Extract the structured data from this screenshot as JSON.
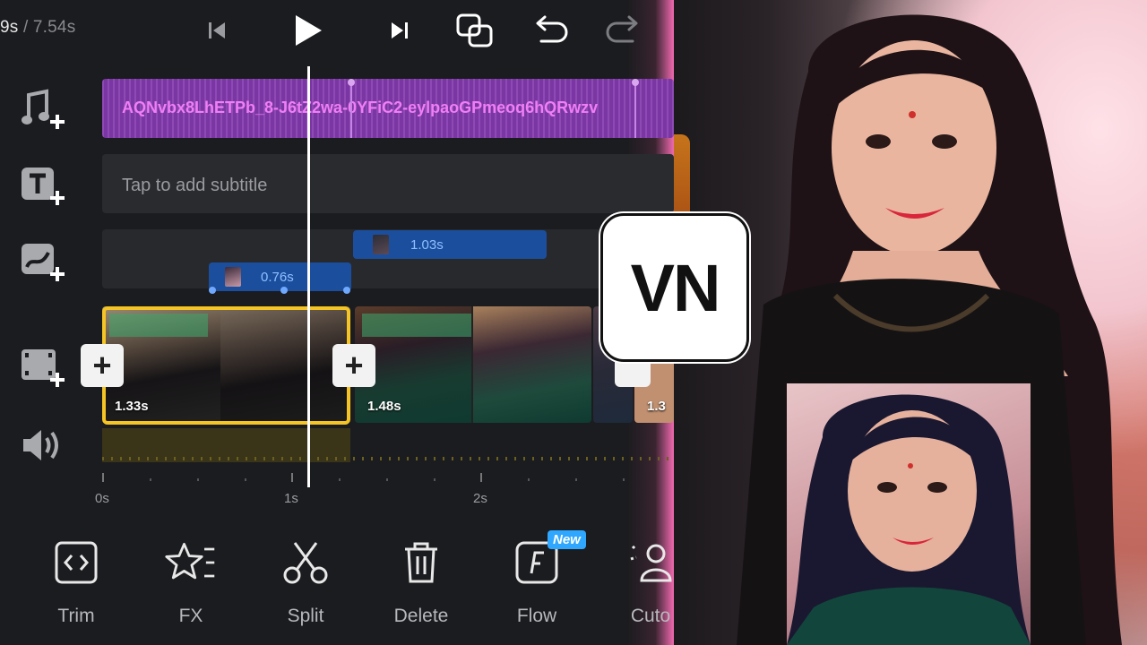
{
  "topbar": {
    "current_time": "9s",
    "total_time": "/ 7.54s",
    "prev_icon": "skip-previous-icon",
    "play_icon": "play-icon",
    "next_icon": "skip-next-icon",
    "compare_icon": "compare-icon",
    "undo_icon": "undo-icon",
    "redo_icon": "redo-icon"
  },
  "tracks": {
    "music": {
      "icon": "music-add-icon",
      "clip_name": "AQNvbx8LhETPb_8-J6tZ2wa-0YFiC2-eylpaoGPmeoq6hQRwzv"
    },
    "subtitle": {
      "icon": "text-add-icon",
      "placeholder": "Tap to add subtitle"
    },
    "overlay": {
      "icon": "overlay-add-icon",
      "clips": [
        {
          "duration": "1.03s"
        },
        {
          "duration": "0.76s"
        }
      ]
    },
    "video": {
      "icon": "video-add-icon",
      "clips": [
        {
          "duration": "1.33s",
          "selected": true
        },
        {
          "duration": "1.48s",
          "selected": false
        },
        {
          "duration": "1.3",
          "selected": false
        }
      ]
    },
    "audio": {
      "icon": "volume-icon"
    }
  },
  "ruler": {
    "labels": [
      "0s",
      "1s",
      "2s"
    ]
  },
  "tools": [
    {
      "label": "Trim",
      "icon": "trim-icon"
    },
    {
      "label": "FX",
      "icon": "fx-star-icon"
    },
    {
      "label": "Split",
      "icon": "scissors-icon"
    },
    {
      "label": "Delete",
      "icon": "trash-icon"
    },
    {
      "label": "Flow",
      "icon": "flow-icon",
      "badge": "New"
    },
    {
      "label": "Cuto",
      "icon": "cutout-icon"
    }
  ],
  "logo": {
    "text": "VN"
  },
  "colors": {
    "editor_bg": "#1b1c1f",
    "music_clip": "#7a37a3",
    "overlay_clip": "#1c4e9e",
    "selection": "#f5c425",
    "badge": "#2fa7ff"
  }
}
